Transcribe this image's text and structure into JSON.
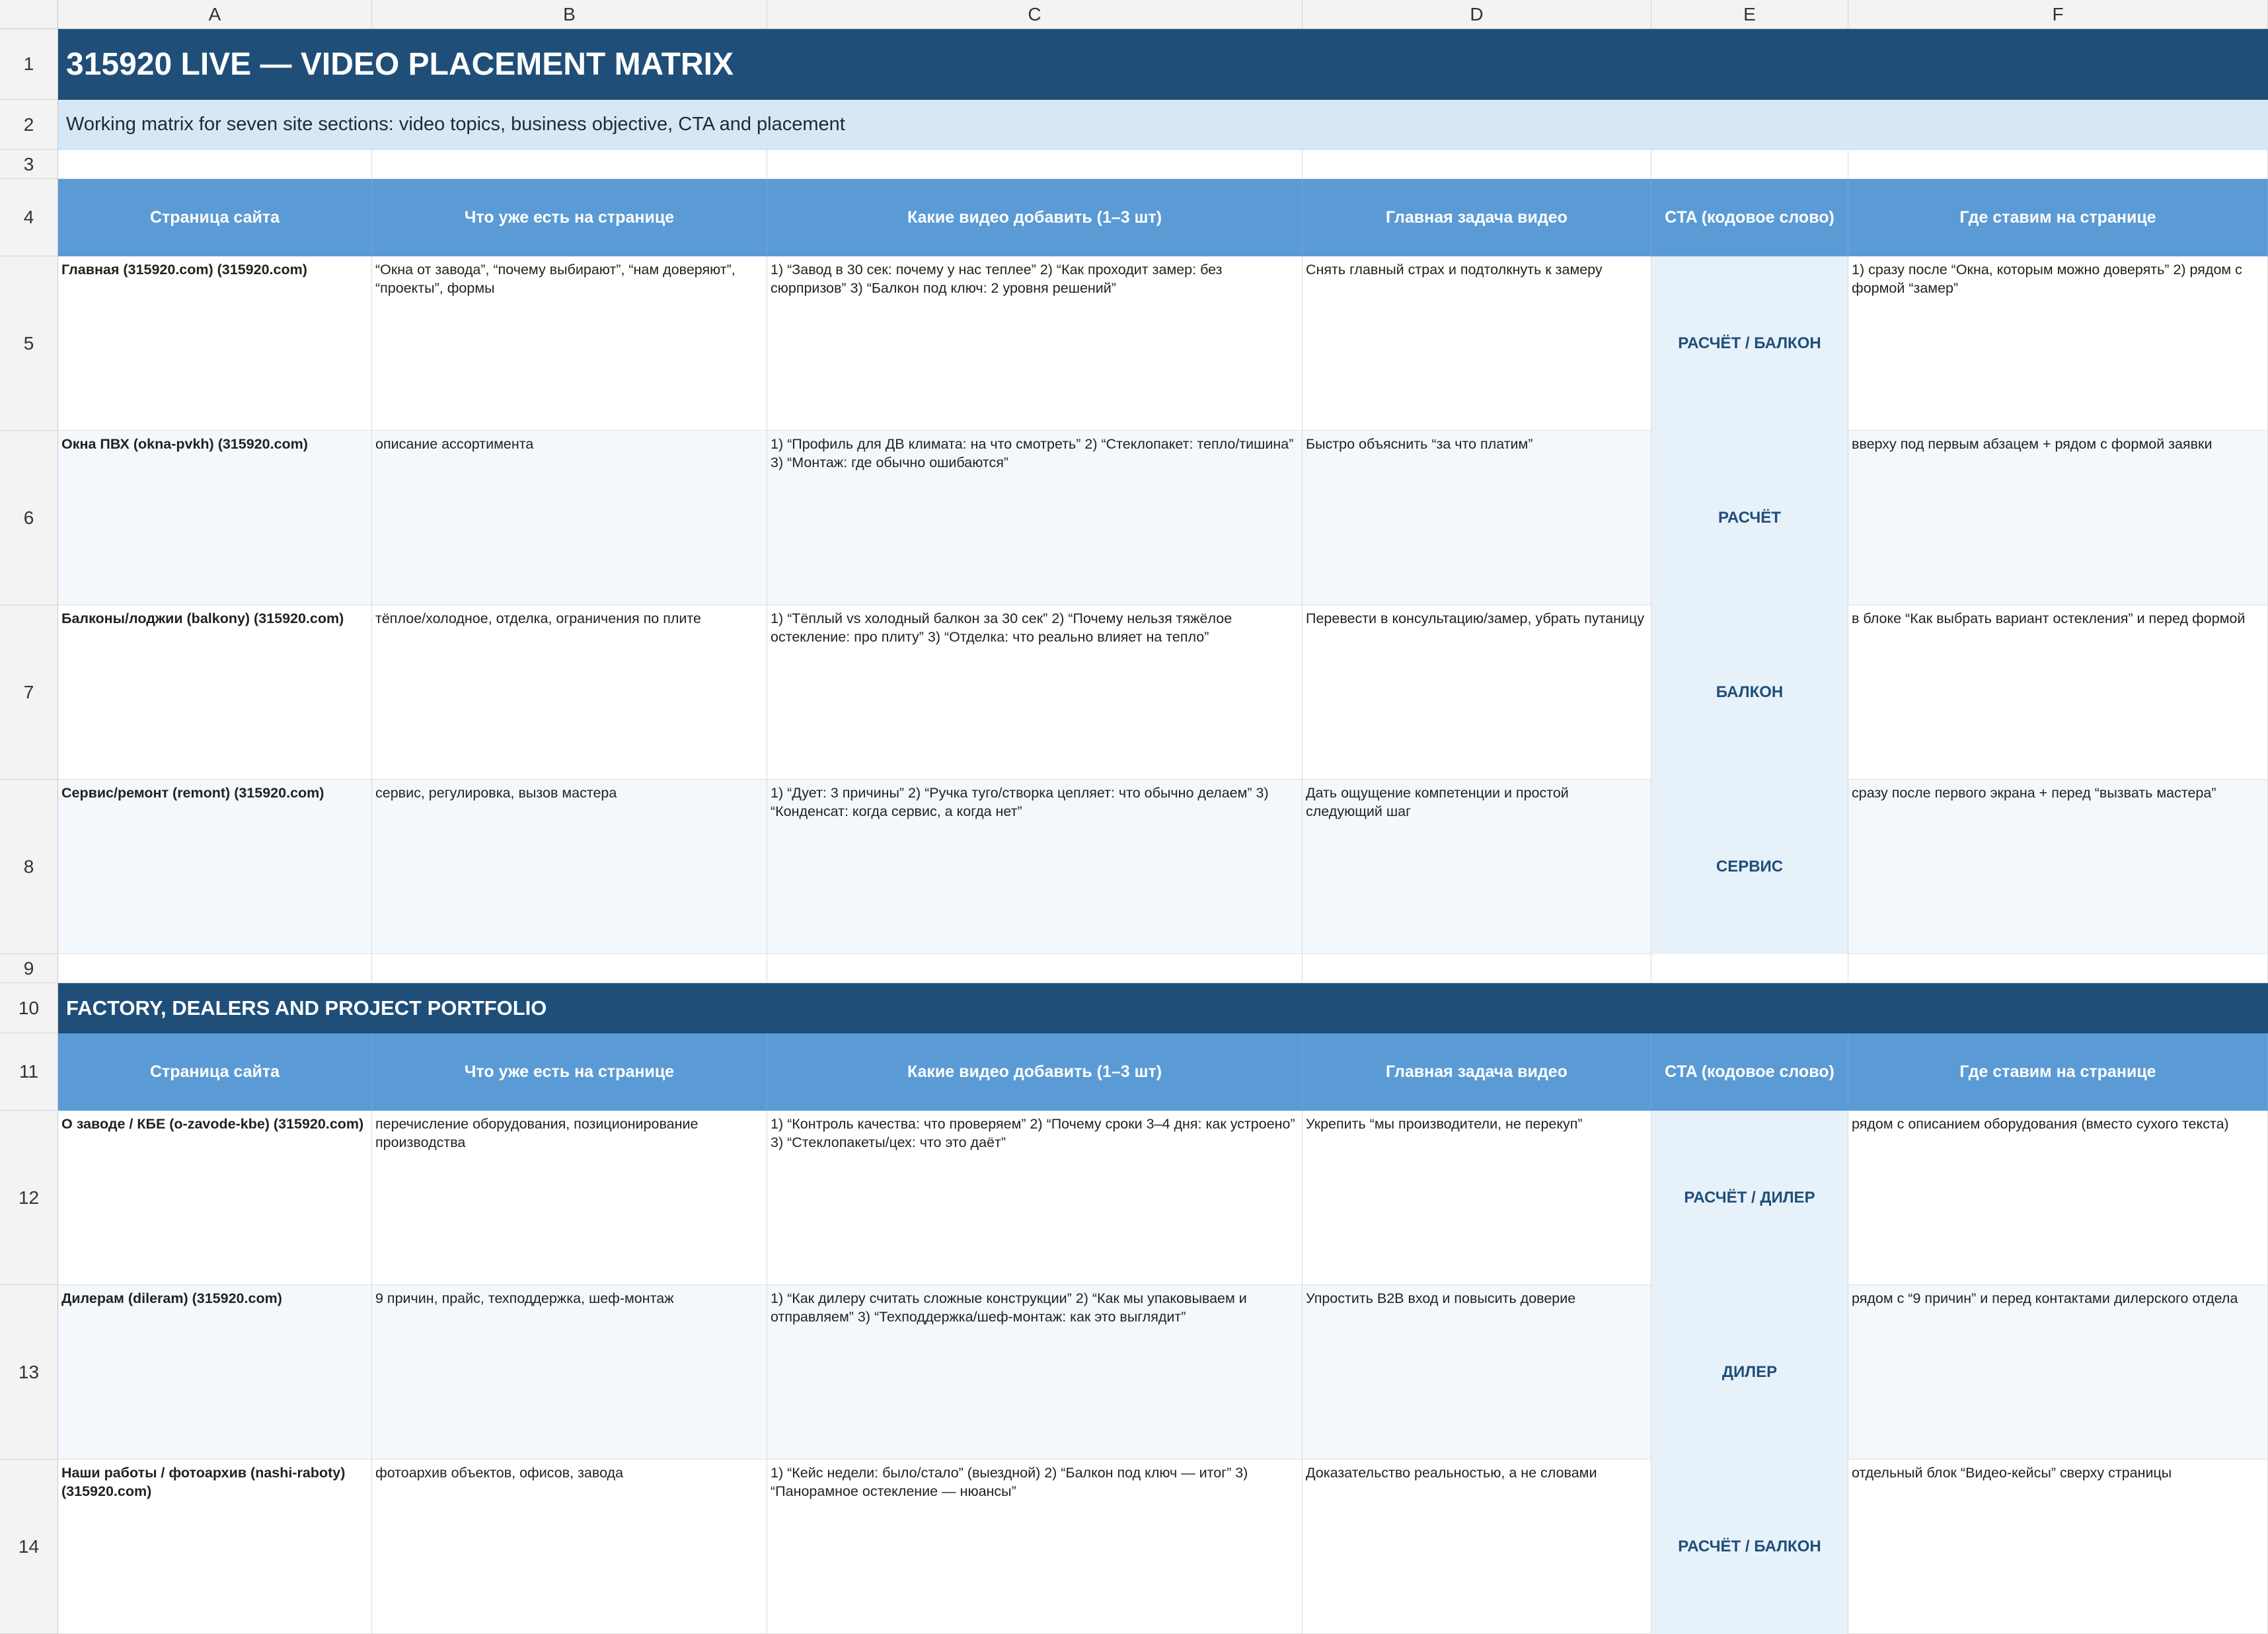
{
  "columns": [
    "A",
    "B",
    "C",
    "D",
    "E",
    "F"
  ],
  "row_numbers": [
    "1",
    "2",
    "3",
    "4",
    "5",
    "6",
    "7",
    "8",
    "9",
    "10",
    "11",
    "12",
    "13",
    "14"
  ],
  "title": "315920 LIVE — VIDEO PLACEMENT MATRIX",
  "subtitle": "Working matrix for seven site sections: video topics, business objective, CTA and placement",
  "section2_title": "FACTORY, DEALERS AND PROJECT PORTFOLIO",
  "headers": [
    "Страница сайта",
    "Что уже есть на странице",
    "Какие видео добавить (1–3 шт)",
    "Главная задача видео",
    "CTA (кодовое слово)",
    "Где ставим на странице"
  ],
  "section1_rows": [
    {
      "page": "Главная (315920.com) (315920.com)",
      "existing": "“Окна от завода”, “почему выбирают”, “нам доверяют”, “проекты”, формы",
      "videos": "1) “Завод в 30 сек: почему у нас теплее” 2) “Как проходит замер: без сюрпризов” 3) “Балкон под ключ: 2 уровня решений”",
      "goal": "Снять главный страх и подтолкнуть к замеру",
      "cta": "РАСЧЁТ / БАЛКОН",
      "placement": "1) сразу после “Окна, которым можно доверять” 2) рядом с формой “замер”"
    },
    {
      "page": "Окна ПВХ (okna-pvkh) (315920.com)",
      "existing": "описание ассортимента",
      "videos": "1) “Профиль для ДВ климата: на что смотреть” 2) “Стеклопакет: тепло/тишина” 3) “Монтаж: где обычно ошибаются”",
      "goal": "Быстро объяснить “за что платим”",
      "cta": "РАСЧЁТ",
      "placement": "вверху под первым абзацем + рядом с формой заявки"
    },
    {
      "page": "Балконы/лоджии (balkony) (315920.com)",
      "existing": "тёплое/холодное, отделка, ограничения по плите",
      "videos": "1) “Тёплый vs холодный балкон за 30 сек” 2) “Почему нельзя тяжёлое остекление: про плиту” 3) “Отделка: что реально влияет на тепло”",
      "goal": "Перевести в консультацию/замер, убрать путаницу",
      "cta": "БАЛКОН",
      "placement": "в блоке “Как выбрать вариант остекления” и перед формой"
    },
    {
      "page": "Сервис/ремонт (remont) (315920.com)",
      "existing": "сервис, регулировка, вызов мастера",
      "videos": "1) “Дует: 3 причины” 2) “Ручка туго/створка цепляет: что обычно делаем” 3) “Конденсат: когда сервис, а когда нет”",
      "goal": "Дать ощущение компетенции и простой следующий шаг",
      "cta": "СЕРВИС",
      "placement": "сразу после первого экрана + перед “вызвать мастера”"
    }
  ],
  "section2_rows": [
    {
      "page": "О заводе / КБЕ (o-zavode-kbe) (315920.com)",
      "existing": "перечисление оборудования, позиционирование производства",
      "videos": "1) “Контроль качества: что проверяем” 2) “Почему сроки 3–4 дня: как устроено” 3) “Стеклопакеты/цех: что это даёт”",
      "goal": "Укрепить “мы производители, не перекуп”",
      "cta": "РАСЧЁТ / ДИЛЕР",
      "placement": "рядом с описанием оборудования (вместо сухого текста)"
    },
    {
      "page": "Дилерам (dileram) (315920.com)",
      "existing": "9 причин, прайс, техподдержка, шеф-монтаж",
      "videos": "1) “Как дилеру считать сложные конструкции” 2) “Как мы упаковываем и отправляем” 3) “Техподдержка/шеф-монтаж: как это выглядит”",
      "goal": "Упростить B2B вход и повысить доверие",
      "cta": "ДИЛЕР",
      "placement": "рядом с “9 причин” и перед контактами дилерского отдела"
    },
    {
      "page": "Наши работы / фотоархив (nashi-raboty) (315920.com)",
      "existing": "фотоархив объектов, офисов, завода",
      "videos": "1) “Кейс недели: было/стало” (выездной) 2) “Балкон под ключ — итог” 3) “Панорамное остекление — нюансы”",
      "goal": "Доказательство реальностью, а не словами",
      "cta": "РАСЧЁТ / БАЛКОН",
      "placement": "отдельный блок “Видео-кейсы” сверху страницы"
    }
  ]
}
